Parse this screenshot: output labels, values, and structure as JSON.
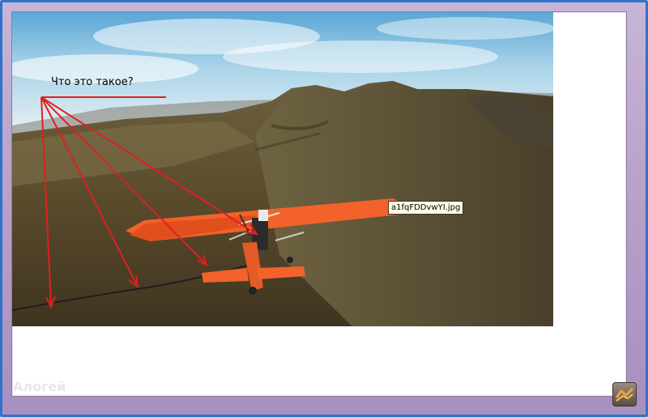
{
  "annotation": {
    "question": "Что это такое?"
  },
  "tooltip": {
    "filename": "a1fqFDDvwYI.jpg"
  },
  "watermark": {
    "text": "Алогей"
  },
  "colors": {
    "frame": "#b6a0c8",
    "frame_edge": "#2f72c9",
    "arrow": "#e0201c",
    "plane": "#f2622a",
    "sky": "#7fb6d6",
    "hills": "#5f5030"
  },
  "icons": {
    "badge": "sunset-badge-icon"
  }
}
